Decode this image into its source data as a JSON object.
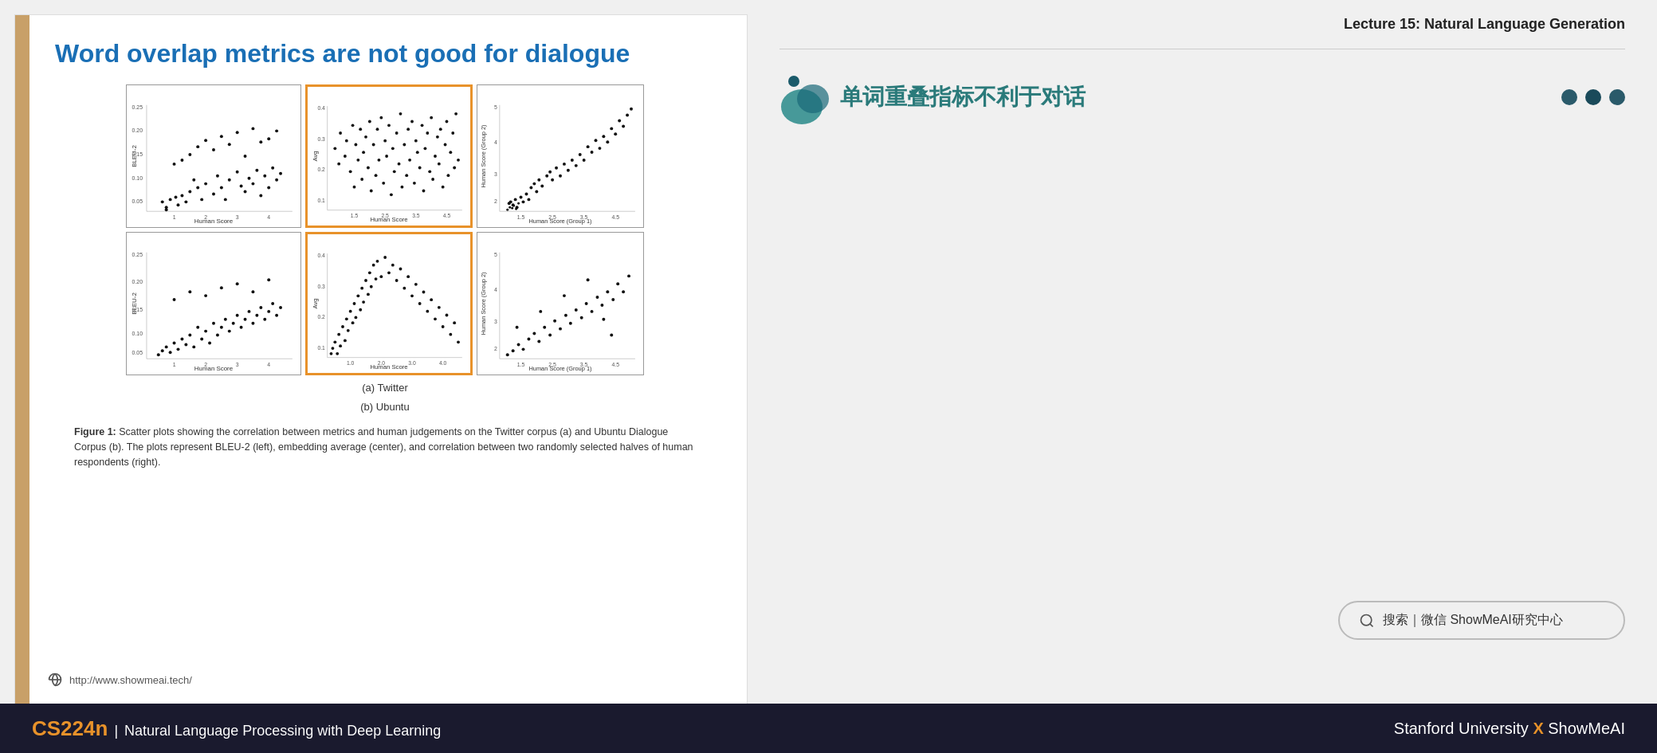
{
  "slide": {
    "title": "Word overlap metrics are not good for dialogue",
    "left_bar_color": "#c8a068",
    "url": "http://www.showmeai.tech/"
  },
  "figure": {
    "caption_num": "Figure 1:",
    "caption_text": "   Scatter plots showing the correlation between metrics and human judgements on the Twitter corpus (a) and Ubuntu Dialogue Corpus (b). The plots represent BLEU-2 (left), embedding average (center), and correlation between two randomly selected halves of human respondents (right).",
    "section_a": "(a) Twitter",
    "section_b": "(b) Ubuntu"
  },
  "right_panel": {
    "lecture_title": "Lecture 15: Natural Language Generation",
    "chinese_title": "单词重叠指标不利于对话",
    "search_text": "搜索｜微信 ShowMeAI研究中心"
  },
  "bottom_bar": {
    "course_code": "CS224n",
    "separator": "|",
    "course_desc": "Natural Language Processing with Deep Learning",
    "right_text": "Stanford University",
    "x_mark": "X",
    "brand": "ShowMeAI"
  },
  "dots": [
    {
      "label": "dot1",
      "active": true
    },
    {
      "label": "dot2",
      "active": true
    },
    {
      "label": "dot3",
      "active": true
    }
  ]
}
